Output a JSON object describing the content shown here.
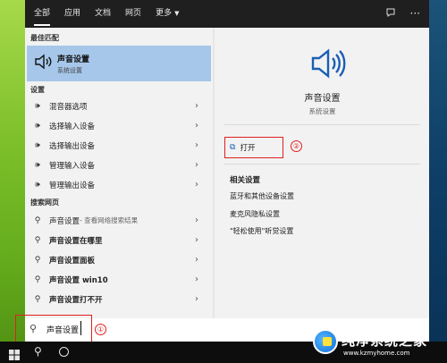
{
  "tabs": [
    "全部",
    "应用",
    "文档",
    "网页",
    "更多"
  ],
  "top_icons": [
    "feedback-icon",
    "more-icon"
  ],
  "left": {
    "best_match_title": "最佳匹配",
    "best_match": {
      "title": "声音设置",
      "subtitle": "系统设置",
      "icon": "speaker-icon"
    },
    "settings_title": "设置",
    "settings_items": [
      {
        "label": "混音器选项",
        "icon": "speaker-icon"
      },
      {
        "label": "选择输入设备",
        "icon": "speaker-icon"
      },
      {
        "label": "选择输出设备",
        "icon": "speaker-icon"
      },
      {
        "label": "管理输入设备",
        "icon": "speaker-icon"
      },
      {
        "label": "管理输出设备",
        "icon": "speaker-icon"
      }
    ],
    "web_title": "搜索网页",
    "web_items": [
      {
        "label": "声音设置",
        "suffix": " - 查看网络搜索结果",
        "icon": "search-icon"
      },
      {
        "label": "声音设置在哪里",
        "icon": "search-icon"
      },
      {
        "label": "声音设置面板",
        "icon": "search-icon"
      },
      {
        "label": "声音设置 win10",
        "icon": "search-icon"
      },
      {
        "label": "声音设置打不开",
        "icon": "search-icon"
      }
    ]
  },
  "right": {
    "title": "声音设置",
    "subtitle": "系统设置",
    "open_label": "打开",
    "related_title": "相关设置",
    "related_links": [
      "蓝牙和其他设备设置",
      "麦克风隐私设置",
      "\"轻松使用\"听觉设置"
    ]
  },
  "annotations": [
    "①",
    "②"
  ],
  "search": {
    "value": "声音设置"
  },
  "watermark": {
    "text": "纯净系统之家",
    "url": "www.kzmyhome.com"
  },
  "colors": {
    "accent": "#1a5fb4",
    "highlight": "#a6c7ea",
    "annotation": "#e02020"
  }
}
